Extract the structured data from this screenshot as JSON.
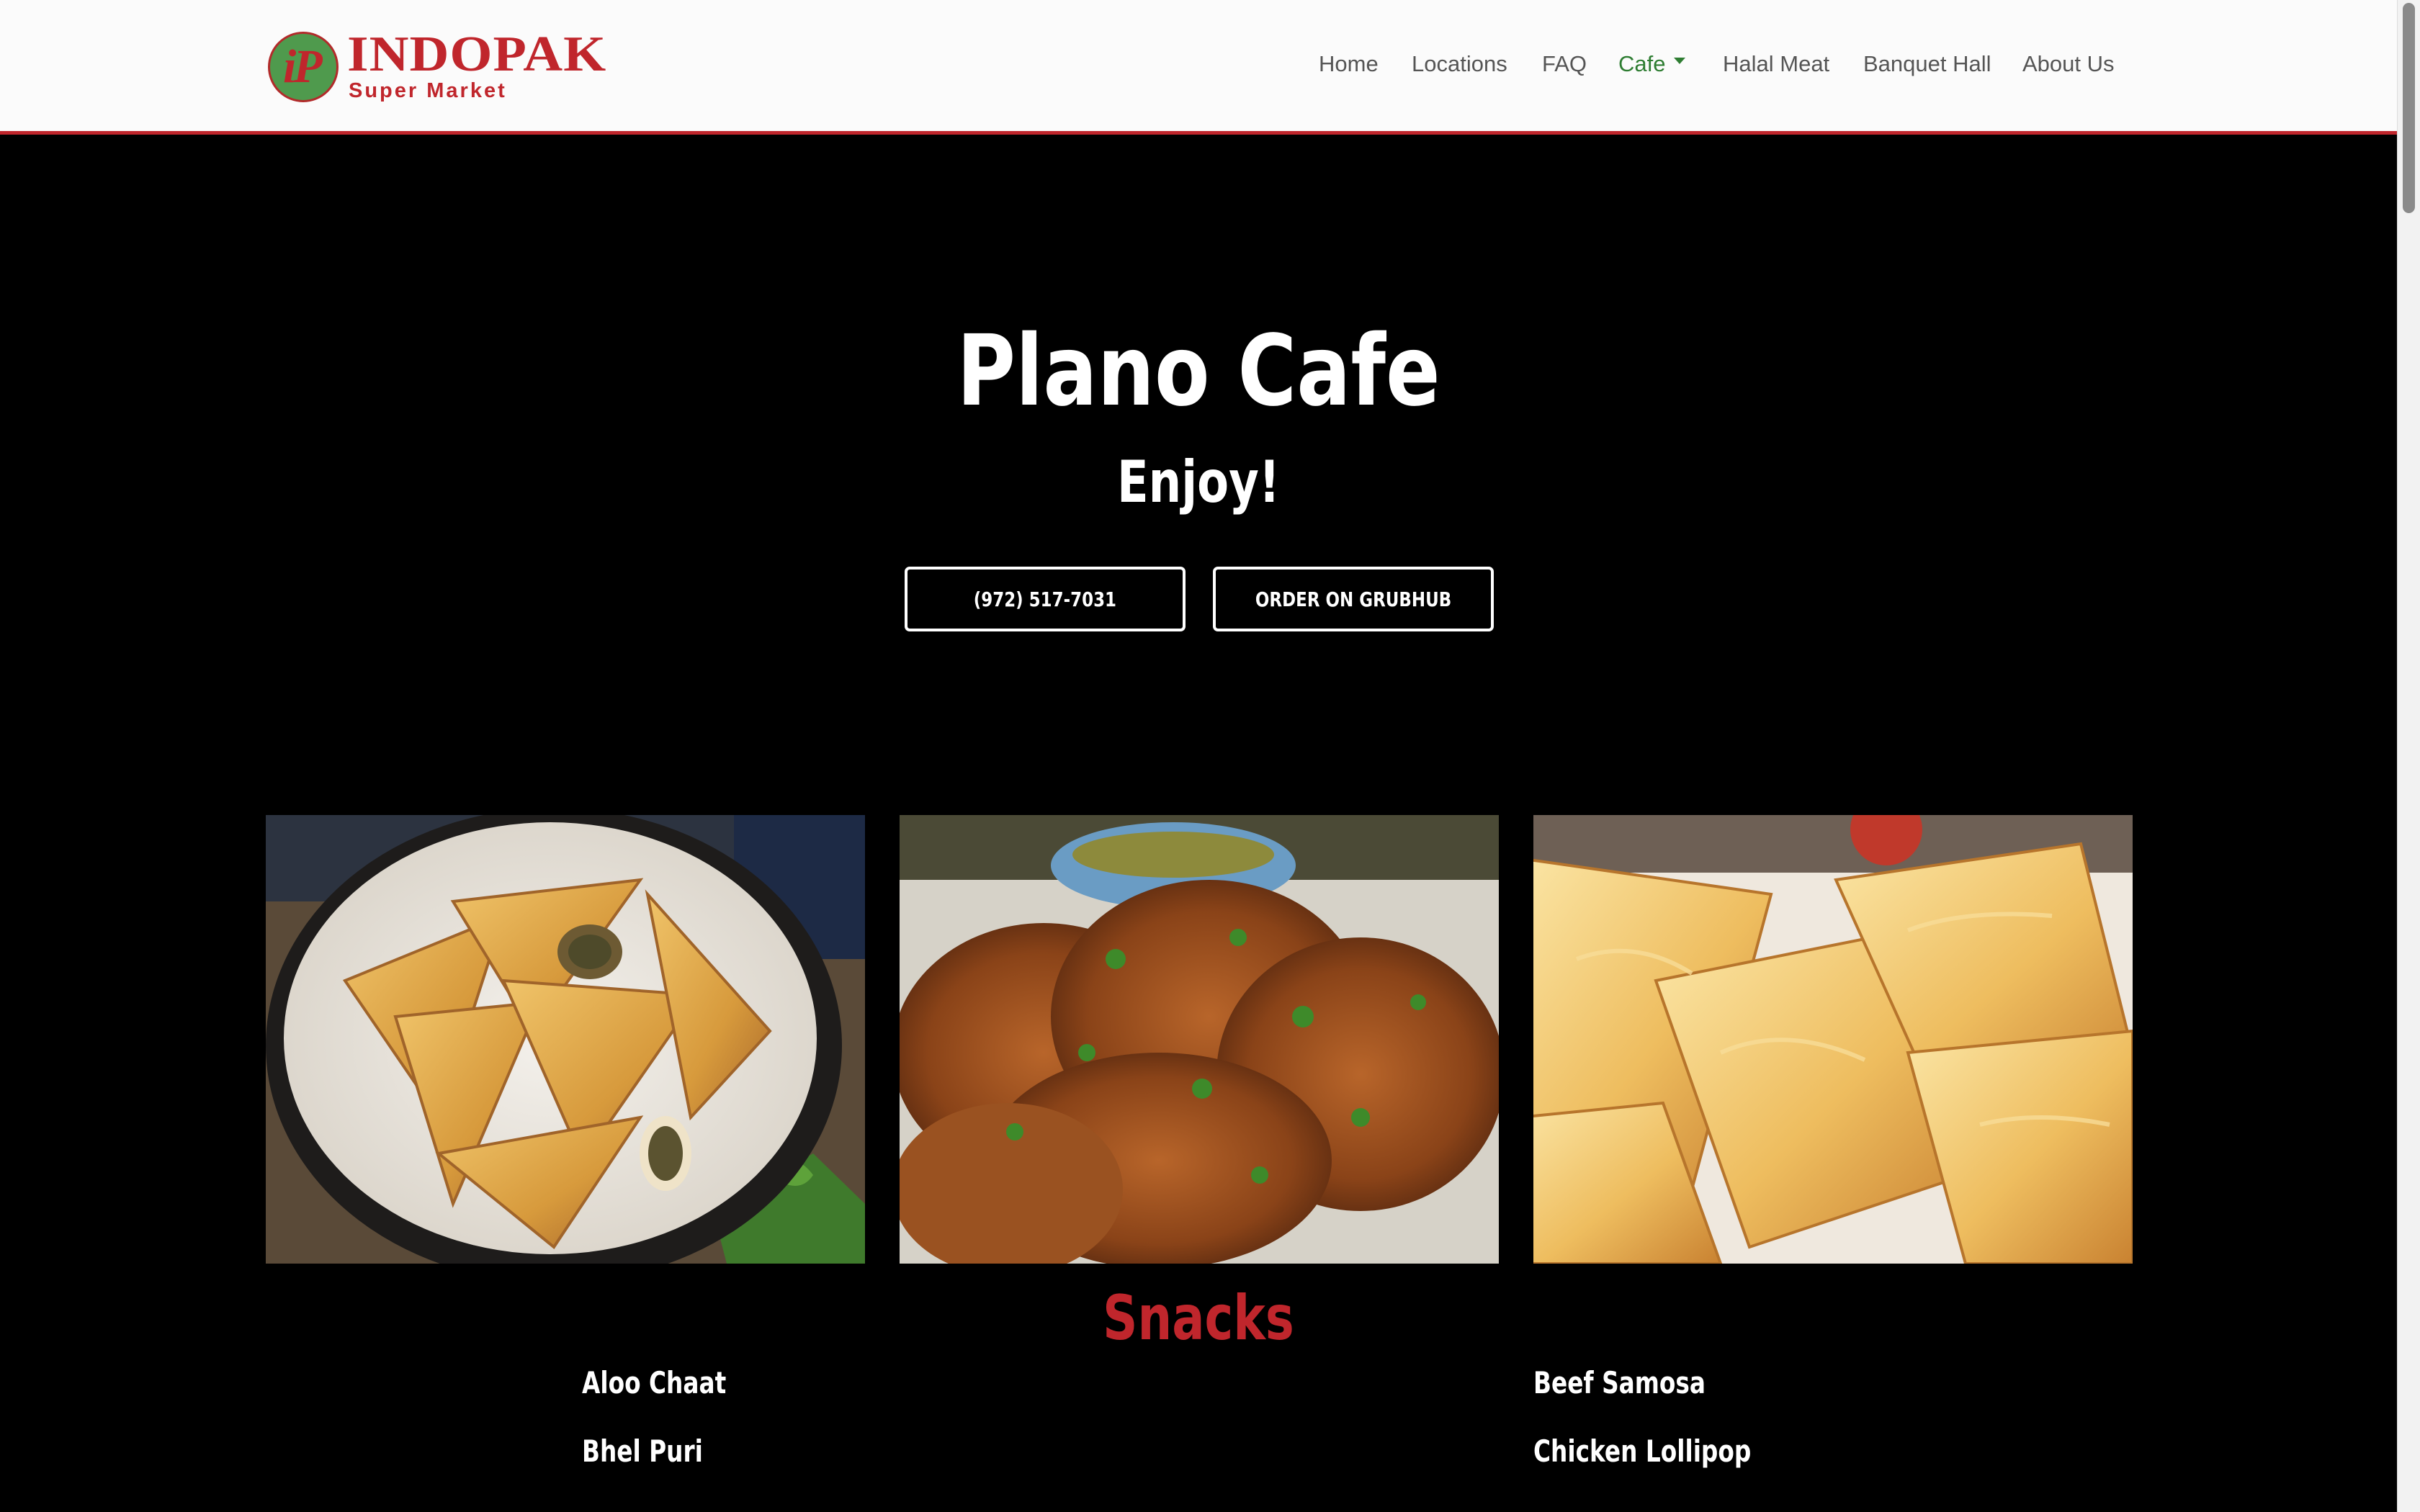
{
  "brand": {
    "logo_initials": "iP",
    "logo_name": "INDOPAK",
    "logo_tagline": "Super Market",
    "accent_red": "#c0262c",
    "accent_green": "#2e7d32"
  },
  "nav": {
    "items": [
      {
        "label": "Home"
      },
      {
        "label": "Locations"
      },
      {
        "label": "FAQ"
      },
      {
        "label": "Cafe",
        "active": true,
        "dropdown": true
      },
      {
        "label": "Halal Meat"
      },
      {
        "label": "Banquet Hall"
      },
      {
        "label": "About Us"
      }
    ]
  },
  "hero": {
    "title": "Plano Cafe",
    "subtitle": "Enjoy!",
    "phone_button": "(972) 517-7031",
    "order_button": "ORDER ON GRUBHUB"
  },
  "photos": [
    {
      "subject": "samosas"
    },
    {
      "subject": "pakoras"
    },
    {
      "subject": "puff pastry patties"
    }
  ],
  "menu": {
    "section_title": "Snacks",
    "left_items": [
      "Aloo Chaat",
      "Bhel Puri"
    ],
    "right_items": [
      "Beef Samosa",
      "Chicken Lollipop"
    ]
  }
}
